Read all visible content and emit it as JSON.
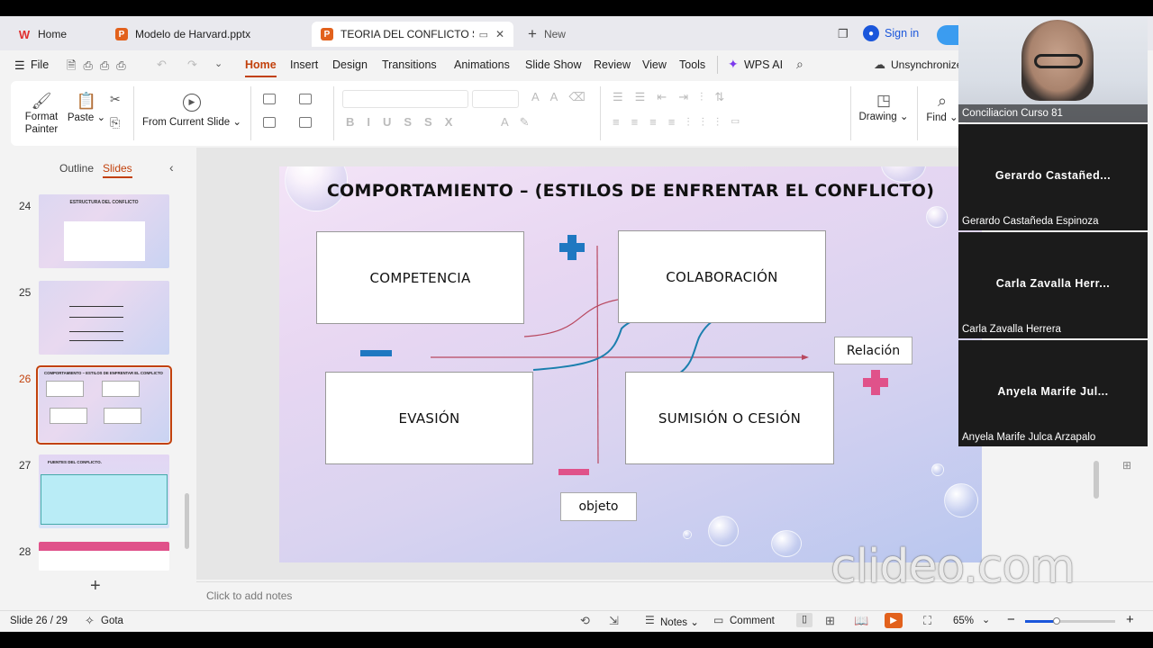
{
  "tabs": [
    {
      "label": "Home",
      "icon": "wps-logo-icon"
    },
    {
      "label": "Modelo de Harvard.pptx",
      "icon": "pptx-file-icon"
    },
    {
      "label": "TEORIA DEL CONFLICTO SOC",
      "icon": "pptx-file-icon"
    },
    {
      "label": "New",
      "icon": "plus-icon"
    }
  ],
  "signin": "Sign in",
  "menu": {
    "file": "File",
    "items": [
      "Home",
      "Insert",
      "Design",
      "Transitions",
      "Animations",
      "Slide Show",
      "Review",
      "View",
      "Tools"
    ],
    "wps_ai": "WPS AI",
    "sync": "Unsynchronized"
  },
  "ribbon": {
    "format_painter": "Format Painter",
    "paste": "Paste",
    "from_current_slide": "From Current Slide",
    "drawing": "Drawing",
    "find": "Find"
  },
  "panel": {
    "outline": "Outline",
    "slides": "Slides"
  },
  "thumbs": [
    {
      "num": "24",
      "title": "ESTRUCTURA DEL CONFLICTO"
    },
    {
      "num": "25",
      "title": ""
    },
    {
      "num": "26",
      "title": "COMPORTAMIENTO – ESTILOS DE ENFRENTAR EL CONFLICTO"
    },
    {
      "num": "27",
      "title": "FUENTES DEL CONFLICTO."
    },
    {
      "num": "28",
      "title": ""
    }
  ],
  "slide": {
    "title": "COMPORTAMIENTO – (ESTILOS DE ENFRENTAR EL CONFLICTO)",
    "boxes": {
      "competencia": "COMPETENCIA",
      "colaboracion": "COLABORACIÓN",
      "evasion": "EVASIÓN",
      "sumision": "SUMISIÓN O CESIÓN"
    },
    "relacion": "Relación",
    "objeto": "objeto",
    "colors": {
      "plus_blue": "#1f78c1",
      "minus_blue": "#1f78c1",
      "plus_pink": "#e0528a",
      "minus_pink": "#e0528a",
      "axis_red": "#b8485f",
      "curve_blue": "#1b7fae"
    }
  },
  "notes_placeholder": "Click to add notes",
  "status": {
    "slide_counter": "Slide 26 / 29",
    "theme": "Gota",
    "notes": "Notes",
    "comment": "Comment",
    "zoom": "65%"
  },
  "video": [
    {
      "name": "Conciliacion Curso 81",
      "big": ""
    },
    {
      "name": "Gerardo Castañeda Espinoza",
      "big": "Gerardo  Castañed..."
    },
    {
      "name": "Carla Zavalla Herrera",
      "big": "Carla  Zavalla  Herr..."
    },
    {
      "name": "Anyela Marife Julca Arzapalo",
      "big": "Anyela  Marife  Jul..."
    }
  ],
  "watermark": "clideo.com"
}
